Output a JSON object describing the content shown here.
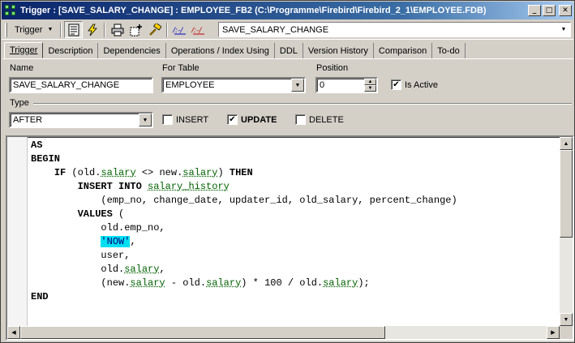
{
  "window": {
    "title": "Trigger : [SAVE_SALARY_CHANGE] : EMPLOYEE_FB2 (C:\\Programme\\Firebird\\Firebird_2_1\\EMPLOYEE.FDB)",
    "minimize": "_",
    "maximize": "□",
    "close": "✕"
  },
  "toolbar": {
    "dropdown_label": "Trigger",
    "dropdown_arrow": "▼",
    "combo_value": "SAVE_SALARY_CHANGE",
    "combo_arrow": "▼",
    "icons": [
      "properties-icon",
      "compile-lightning-icon",
      "print-icon",
      "add-object-icon",
      "tools-icon",
      "link-icon",
      "unlink-icon"
    ]
  },
  "tabs": [
    {
      "label": "Trigger",
      "active": true
    },
    {
      "label": "Description"
    },
    {
      "label": "Dependencies"
    },
    {
      "label": "Operations / Index Using"
    },
    {
      "label": "DDL"
    },
    {
      "label": "Version History"
    },
    {
      "label": "Comparison"
    },
    {
      "label": "To-do"
    }
  ],
  "form": {
    "name_label": "Name",
    "name_value": "SAVE_SALARY_CHANGE",
    "table_label": "For Table",
    "table_value": "EMPLOYEE",
    "position_label": "Position",
    "position_value": "0",
    "is_active_label": "Is Active",
    "is_active_checked": "✔",
    "type_label": "Type",
    "type_value": "AFTER",
    "insert_label": "INSERT",
    "update_label": "UPDATE",
    "update_checked": "✔",
    "delete_label": "DELETE",
    "combo_arrow": "▼",
    "spin_up": "▲",
    "spin_down": "▼"
  },
  "editor": {
    "lines": [
      [
        {
          "t": "AS",
          "k": "kw"
        }
      ],
      [
        {
          "t": "BEGIN",
          "k": "kw"
        }
      ],
      [
        {
          "t": "    "
        },
        {
          "t": "IF",
          "k": "kw"
        },
        {
          "t": " (old."
        },
        {
          "t": "salary",
          "k": "id"
        },
        {
          "t": " <> new."
        },
        {
          "t": "salary",
          "k": "id"
        },
        {
          "t": ") "
        },
        {
          "t": "THEN",
          "k": "kw"
        }
      ],
      [
        {
          "t": "        "
        },
        {
          "t": "INSERT INTO",
          "k": "kw"
        },
        {
          "t": " "
        },
        {
          "t": "salary_history",
          "k": "id"
        }
      ],
      [
        {
          "t": "            (emp_no, change_date, updater_id, old_salary, percent_change)"
        }
      ],
      [
        {
          "t": "        "
        },
        {
          "t": "VALUES",
          "k": "kw"
        },
        {
          "t": " ("
        }
      ],
      [
        {
          "t": "            old.emp_no,"
        }
      ],
      [
        {
          "t": "            "
        },
        {
          "t": "'NOW'",
          "k": "str"
        },
        {
          "t": ","
        }
      ],
      [
        {
          "t": "            user,"
        }
      ],
      [
        {
          "t": "            old."
        },
        {
          "t": "salary",
          "k": "id"
        },
        {
          "t": ","
        }
      ],
      [
        {
          "t": "            (new."
        },
        {
          "t": "salary",
          "k": "id"
        },
        {
          "t": " - old."
        },
        {
          "t": "salary",
          "k": "id"
        },
        {
          "t": ") * 100 / old."
        },
        {
          "t": "salary",
          "k": "id"
        },
        {
          "t": ");"
        }
      ],
      [
        {
          "t": "END",
          "k": "kw"
        }
      ]
    ],
    "scroll_up": "▲",
    "scroll_down": "▼",
    "scroll_left": "◀",
    "scroll_right": "▶"
  }
}
